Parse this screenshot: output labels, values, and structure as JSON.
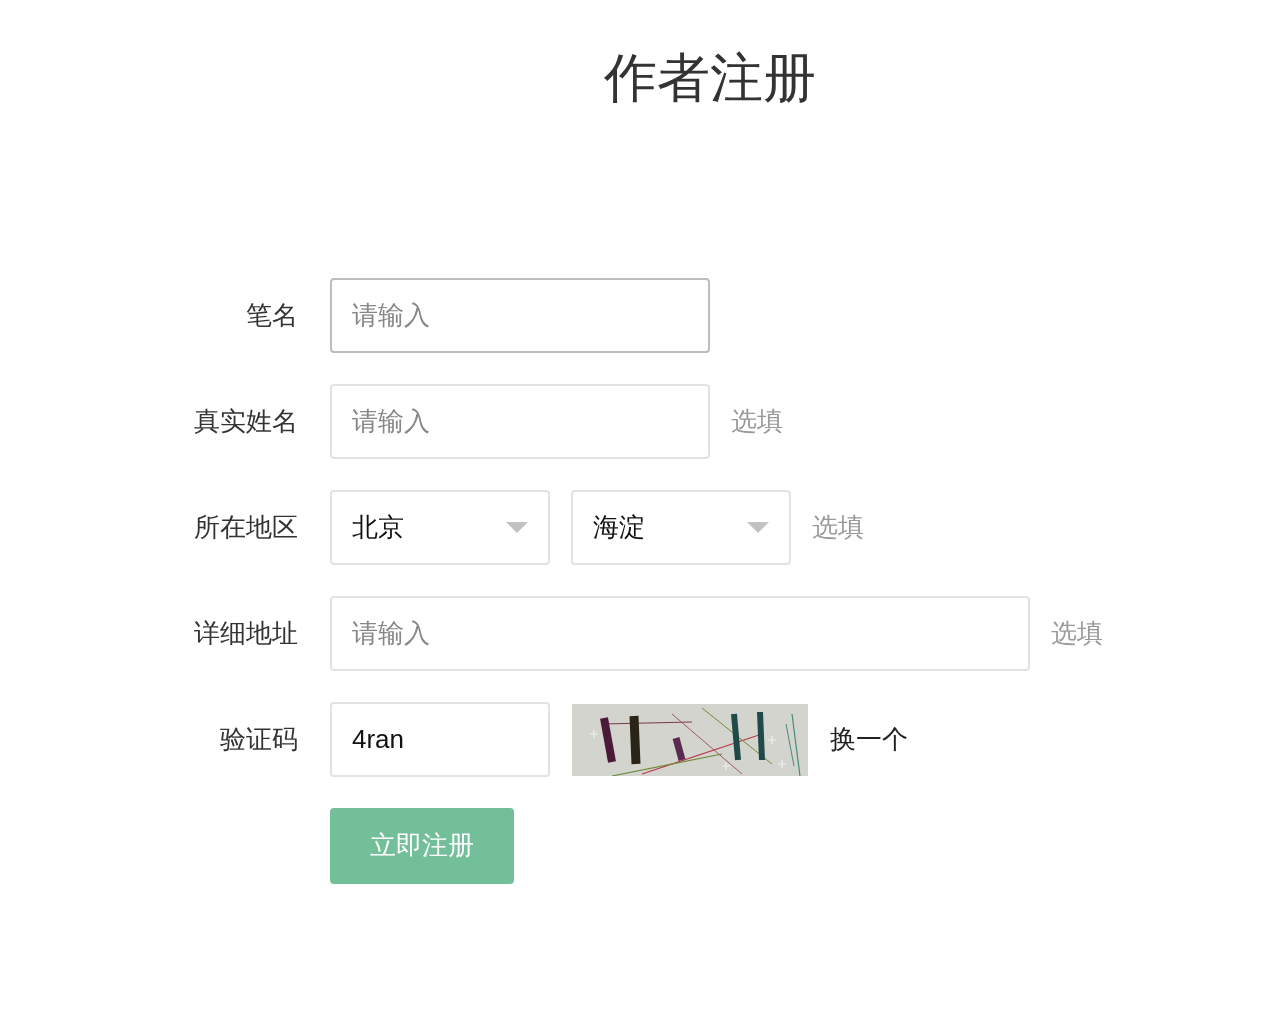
{
  "title": "作者注册",
  "rows": [
    {
      "kind": "text",
      "label": "笔名",
      "input": {
        "placeholder": "请输入",
        "focused": true
      }
    },
    {
      "kind": "text",
      "label": "真实姓名",
      "input": {
        "placeholder": "请输入",
        "focused": false
      },
      "hint": "选填"
    },
    {
      "kind": "select",
      "label": "所在地区",
      "selects": [
        {
          "value": "北京"
        },
        {
          "value": "海淀"
        }
      ],
      "hint": "选填"
    },
    {
      "kind": "long_text",
      "label": "详细地址",
      "input": {
        "placeholder": "请输入",
        "focused": false
      },
      "hint": "选填"
    },
    {
      "kind": "captcha",
      "label": "验证码",
      "input": {
        "value": "4ran",
        "focused": false
      },
      "refresh_link": "换一个"
    }
  ],
  "submit_button": "立即注册"
}
